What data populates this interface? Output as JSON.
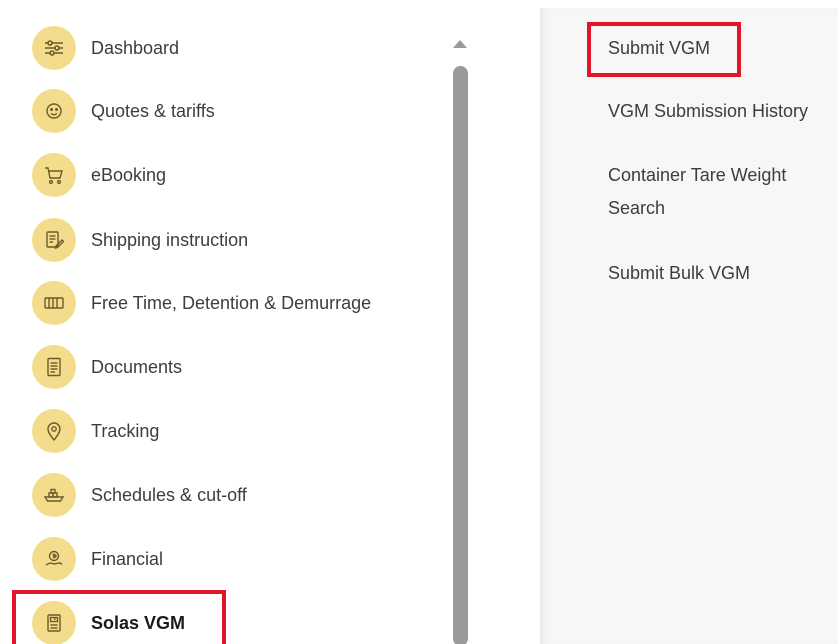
{
  "sidebar": {
    "items": [
      {
        "label": "Dashboard",
        "icon": "sliders-icon"
      },
      {
        "label": "Quotes & tariffs",
        "icon": "money-face-icon"
      },
      {
        "label": "eBooking",
        "icon": "cart-icon"
      },
      {
        "label": "Shipping instruction",
        "icon": "document-pen-icon"
      },
      {
        "label": "Free Time, Detention & Demurrage",
        "icon": "container-icon"
      },
      {
        "label": "Documents",
        "icon": "document-list-icon"
      },
      {
        "label": "Tracking",
        "icon": "location-pin-icon"
      },
      {
        "label": "Schedules & cut-off",
        "icon": "ship-icon"
      },
      {
        "label": "Financial",
        "icon": "coin-hand-icon"
      },
      {
        "label": "Solas VGM",
        "icon": "scale-icon",
        "active": true
      }
    ]
  },
  "submenu": {
    "items": [
      {
        "label": "Submit VGM"
      },
      {
        "label": "VGM Submission History"
      },
      {
        "label": "Container Tare Weight"
      },
      {
        "label": "Search"
      },
      {
        "label": "Submit Bulk VGM"
      }
    ]
  },
  "colors": {
    "icon_bg": "#f3dd8c",
    "highlight": "#e0172b",
    "submenu_bg": "#f7f7f7",
    "scrollbar": "#9a9a9a"
  }
}
